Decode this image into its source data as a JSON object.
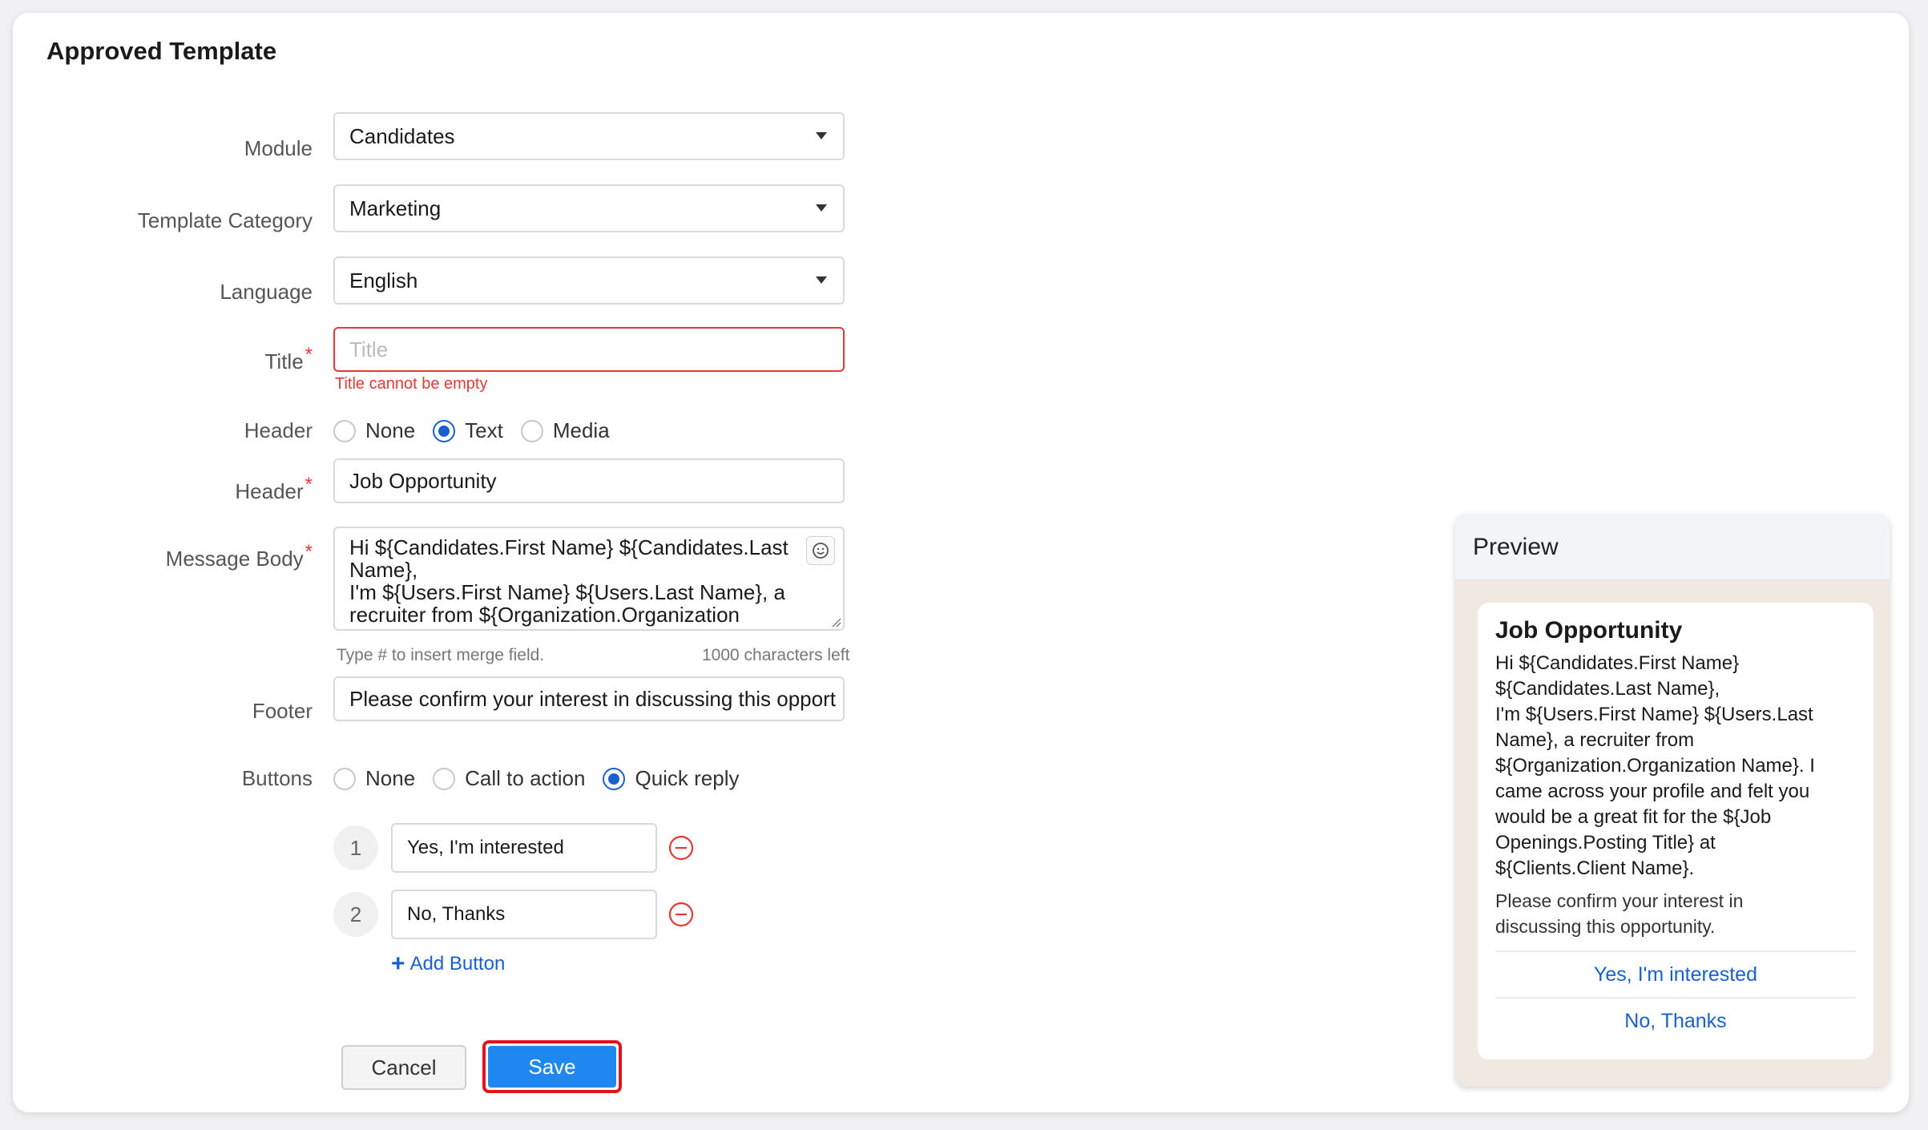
{
  "page": {
    "title": "Approved Template"
  },
  "form": {
    "module": {
      "label": "Module",
      "value": "Candidates"
    },
    "category": {
      "label": "Template Category",
      "value": "Marketing"
    },
    "language": {
      "label": "Language",
      "value": "English"
    },
    "title": {
      "label": "Title",
      "required_mark": "*",
      "placeholder": "Title",
      "error": "Title cannot be empty"
    },
    "header_type": {
      "label": "Header",
      "options": [
        "None",
        "Text",
        "Media"
      ],
      "selected": "Text"
    },
    "header": {
      "label": "Header",
      "required_mark": "*",
      "value": "Job Opportunity"
    },
    "message_body": {
      "label": "Message Body",
      "required_mark": "*",
      "lines": [
        "Hi ${Candidates.First Name} ${Candidates.Last",
        "Name},",
        "I'm ${Users.First Name} ${Users.Last Name}, a",
        "recruiter from ${Organization.Organization"
      ],
      "hint": "Type # to insert merge field.",
      "counter": "1000 characters left"
    },
    "footer": {
      "label": "Footer",
      "value": "Please confirm your interest in discussing this opport"
    },
    "buttons_type": {
      "label": "Buttons",
      "options": [
        "None",
        "Call to action",
        "Quick reply"
      ],
      "selected": "Quick reply"
    },
    "quick_replies": [
      {
        "index": "1",
        "value": "Yes, I'm interested"
      },
      {
        "index": "2",
        "value": "No, Thanks"
      }
    ],
    "add_button_label": "Add Button",
    "cancel_label": "Cancel",
    "save_label": "Save"
  },
  "preview": {
    "heading": "Preview",
    "title": "Job Opportunity",
    "body_lines": [
      "Hi ${Candidates.First Name}",
      "${Candidates.Last Name},",
      "I'm ${Users.First Name} ${Users.Last",
      "Name}, a recruiter from",
      "${Organization.Organization Name}. I",
      "came across your profile and felt you",
      "would be a great fit for the ${Job",
      "Openings.Posting Title} at",
      "${Clients.Client Name}."
    ],
    "footer_lines": [
      "Please confirm your interest in",
      "discussing this opportunity."
    ],
    "buttons": [
      "Yes, I'm interested",
      "No, Thanks"
    ]
  },
  "colors": {
    "accent": "#1a5fd0",
    "error": "#e53935",
    "save": "#1e88f0",
    "highlight": "#e0141e"
  },
  "icons": {
    "dropdown": "caret-down-icon",
    "emoji": "smiley-icon",
    "remove": "minus-circle-icon",
    "add": "plus-icon"
  }
}
